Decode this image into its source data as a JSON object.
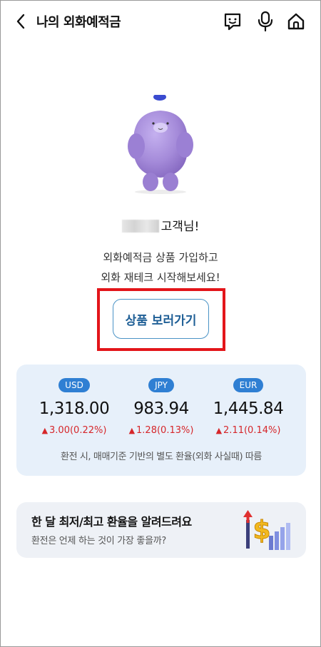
{
  "header": {
    "title": "나의 외화예적금",
    "icons": [
      "chevron-left-icon",
      "chat-face-icon",
      "microphone-icon",
      "home-icon"
    ]
  },
  "greeting": {
    "suffix": "고객님!"
  },
  "promo": {
    "line1": "외화예적금 상품 가입하고",
    "line2": "외화 재테크 시작해보세요!"
  },
  "cta": {
    "label": "상품 보러가기"
  },
  "rates": {
    "items": [
      {
        "currency": "USD",
        "value": "1,318.00",
        "change": "3.00(0.22%)"
      },
      {
        "currency": "JPY",
        "value": "983.94",
        "change": "1.28(0.13%)"
      },
      {
        "currency": "EUR",
        "value": "1,445.84",
        "change": "2.11(0.14%)"
      }
    ],
    "note": "환전 시, 매매기준 기반의 별도 환율(외화 사실때) 따름",
    "accent_color": "#2f7fd3",
    "up_color": "#d6262a"
  },
  "alert": {
    "title": "한 달 최저/최고 환율을 알려드려요",
    "subtitle": "환전은 언제 하는 것이 가장 좋을까?"
  },
  "highlight_color": "#e3151a"
}
